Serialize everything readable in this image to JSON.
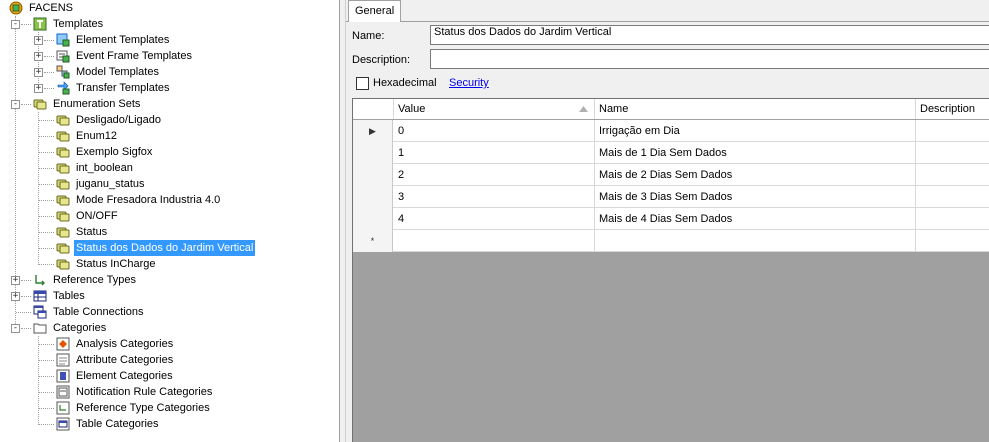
{
  "tree": {
    "root": "FACENS",
    "templates": {
      "label": "Templates",
      "items": [
        "Element Templates",
        "Event Frame Templates",
        "Model Templates",
        "Transfer Templates"
      ]
    },
    "enumeration_sets": {
      "label": "Enumeration Sets",
      "items": [
        "Desligado/Ligado",
        "Enum12",
        "Exemplo Sigfox",
        "int_boolean",
        "juganu_status",
        "Mode Fresadora Industria 4.0",
        "ON/OFF",
        "Status",
        "Status dos Dados do Jardim Vertical",
        "Status InCharge"
      ],
      "selected": "Status dos Dados do Jardim Vertical"
    },
    "reference_types": "Reference Types",
    "tables": "Tables",
    "table_connections": "Table Connections",
    "categories": {
      "label": "Categories",
      "items": [
        "Analysis Categories",
        "Attribute Categories",
        "Element Categories",
        "Notification Rule Categories",
        "Reference Type Categories",
        "Table Categories"
      ]
    }
  },
  "detail": {
    "tab": "General",
    "name_label": "Name:",
    "name_value": "Status dos Dados do Jardim Vertical",
    "description_label": "Description:",
    "description_value": "",
    "hexadecimal_label": "Hexadecimal",
    "hexadecimal_checked": false,
    "security_link": "Security",
    "grid": {
      "columns": [
        "Value",
        "Name",
        "Description"
      ],
      "rows": [
        {
          "value": "0",
          "name": "Irrigação em Dia",
          "description": ""
        },
        {
          "value": "1",
          "name": "Mais de 1 Dia Sem Dados",
          "description": ""
        },
        {
          "value": "2",
          "name": "Mais de 2 Dias Sem Dados",
          "description": ""
        },
        {
          "value": "3",
          "name": "Mais de 3 Dias Sem Dados",
          "description": ""
        },
        {
          "value": "4",
          "name": "Mais de 4 Dias Sem Dados",
          "description": ""
        }
      ],
      "current_row_marker": "▶",
      "new_row_marker": "*"
    }
  },
  "colors": {
    "selection": "#3399ff",
    "link": "#0000ee",
    "grid_empty": "#a0a0a0"
  }
}
